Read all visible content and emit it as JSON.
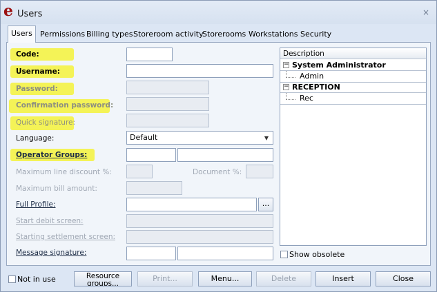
{
  "window": {
    "title": "Users",
    "logo_letter": "e",
    "close_glyph": "×"
  },
  "tabs": [
    {
      "label": "Users",
      "active": true
    },
    {
      "label": "Permissions"
    },
    {
      "label": "Billing types"
    },
    {
      "label": "Storeroom activity"
    },
    {
      "label": "Storerooms"
    },
    {
      "label": "Workstations"
    },
    {
      "label": "Security"
    }
  ],
  "form": {
    "code_label": "Code:",
    "username_label": "Username:",
    "password_label": "Password:",
    "confirmation_label": "Confirmation password:",
    "quick_signature_label": "Quick signature:",
    "language_label": "Language:",
    "language_value": "Default",
    "operator_groups_label": "Operator Groups:",
    "max_line_discount_label": "Maximum line discount %:",
    "document_label": "Document %:",
    "max_bill_amount_label": "Maximum bill amount:",
    "full_profile_label": "Full Profile:",
    "ellipsis_label": "...",
    "start_debit_label": "Start debit screen:",
    "starting_settlement_label": "Starting settlement screen:",
    "message_signature_label": "Message signature:"
  },
  "tree": {
    "header": "Description",
    "groups": [
      {
        "label": "System Administrator",
        "expander": "−",
        "children": [
          "Admin"
        ]
      },
      {
        "label": "RECEPTION",
        "expander": "−",
        "children": [
          "Rec"
        ]
      }
    ]
  },
  "show_obsolete_label": "Show obsolete",
  "bottom": {
    "not_in_use_label": "Not in use",
    "resource_groups_line1": "Resource",
    "resource_groups_line2": "groups...",
    "print_label": "Print...",
    "menu_label": "Menu...",
    "delete_label": "Delete",
    "insert_label": "Insert",
    "close_label": "Close"
  },
  "colors": {
    "highlight": "#f4f23a",
    "logo": "#9b1111"
  }
}
